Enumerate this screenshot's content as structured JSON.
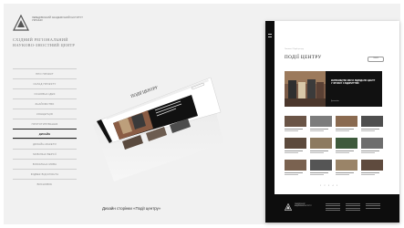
{
  "sidebar": {
    "logo_text": "ЛЕБЕДІВСЬКИЙ АКАДЕМІЧНИЙ ІНСТИТУТ УКРАЇНИ",
    "institute_title": "СХІДНИЙ РЕГІОНАЛЬНИЙ НАУКОВО-ЗНОСТНИЙ ЦЕНТР",
    "nav": [
      {
        "label": "ПРО ПРОЄКТ"
      },
      {
        "label": "СКЛАД ПРОЄКТУ"
      },
      {
        "label": "ОСНОВНА ІДЕЯ"
      },
      {
        "label": "ЗНАЙОМСТВО"
      },
      {
        "label": "КОНЦЕПЦІЯ"
      },
      {
        "label": "ПРОТОТИПУВАННЯ"
      },
      {
        "label": "ДИЗАЙН"
      },
      {
        "label": "ДИЗАЙН-МАКЕТИ"
      },
      {
        "label": "МОБІЛЬНІ ВЕРСІЇ"
      },
      {
        "label": "ВІЗУАЛЬНА МОВА"
      },
      {
        "label": "ФІДБЕК ВІД КЛІЄНТА"
      },
      {
        "label": "ВИСНОВОК"
      }
    ],
    "active_index": 6
  },
  "caption": "Дизайн сторінки «Події центру»",
  "mockup": {
    "page_title": "ПОДІЇ ЦЕНТРУ",
    "breadcrumb": "Головна / Події центру",
    "search_label": "ПОШУК",
    "feature_title": "КЕРІВНИЦТВО МІСТА ВІДВІДАЛО ЦЕНТР У ЗВ'ЯЗКУ З ВІДКРИТТЯМ",
    "feature_more": "Детальніше",
    "pager": "1 2 3 4 5",
    "footer_text": "ЛЕБЕДІВСЬКИЙ АКАДЕМІЧНИЙ ІНСТИТУТ"
  },
  "colors": {
    "background": "#f1f1f1",
    "dark": "#0d0d0d",
    "accent_text": "#111111"
  }
}
